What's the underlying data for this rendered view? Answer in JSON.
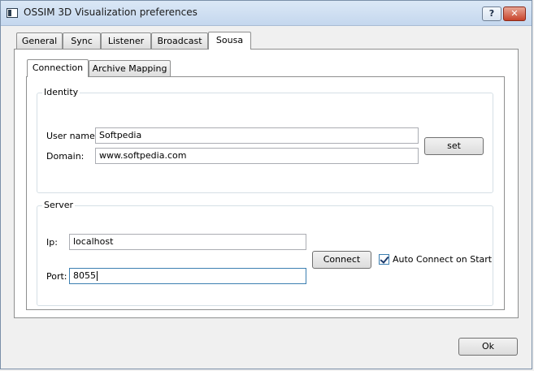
{
  "window": {
    "title": "OSSIM 3D Visualization preferences",
    "help_label": "?",
    "close_label": "✕"
  },
  "tabs": [
    "General",
    "Sync",
    "Listener",
    "Broadcast",
    "Sousa"
  ],
  "subtabs": [
    "Connection",
    "Archive Mapping"
  ],
  "identity": {
    "title": "Identity",
    "username_label": "User name:",
    "username_value": "Softpedia",
    "domain_label": "Domain:",
    "domain_value": "www.softpedia.com",
    "set_label": "set"
  },
  "server": {
    "title": "Server",
    "ip_label": "Ip:",
    "ip_value": "localhost",
    "port_label": "Port:",
    "port_value": "8055",
    "connect_label": "Connect",
    "auto_connect_label": "Auto Connect on Start",
    "auto_connect_checked": true
  },
  "footer": {
    "ok_label": "Ok"
  }
}
